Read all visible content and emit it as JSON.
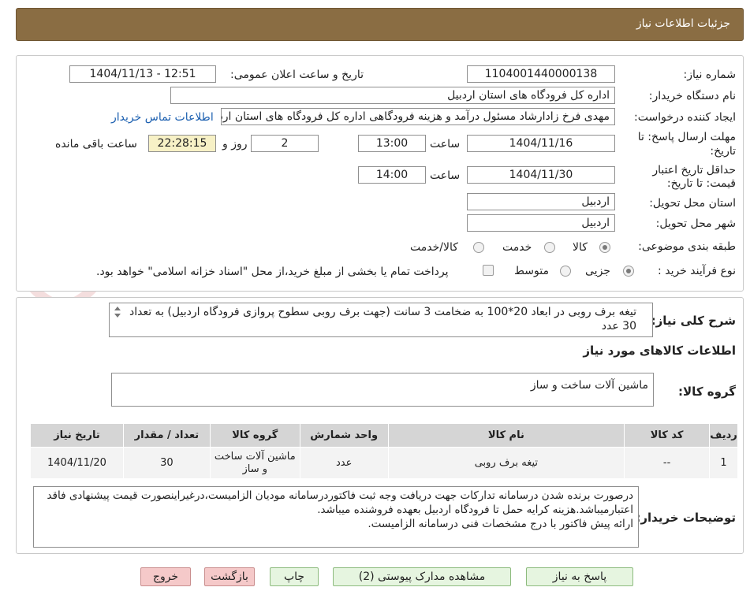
{
  "header": {
    "title": "جزئیات اطلاعات نیاز"
  },
  "form": {
    "need_number_label": "شماره نیاز:",
    "need_number": "1104001440000138",
    "announce_label": "تاریخ و ساعت اعلان عمومی:",
    "announce_value": "1404/11/13 - 12:51",
    "buyer_org_label": "نام دستگاه خریدار:",
    "buyer_org": "اداره کل فرودگاه های استان اردبیل",
    "creator_label": "ایجاد کننده درخواست:",
    "creator": "مهدی فرخ زادارشاد مسئول درآمد و هزینه فرودگاهی اداره کل فرودگاه های استان اردبیل",
    "contact_link": "اطلاعات تماس خریدار",
    "deadline_label_1": "مهلت ارسال پاسخ: تا",
    "deadline_label_2": "تاریخ:",
    "deadline_date": "1404/11/16",
    "time_label": "ساعت",
    "deadline_time": "13:00",
    "days_value": "2",
    "days_label": "روز و",
    "remaining_time": "22:28:15",
    "remaining_label": "ساعت باقی مانده",
    "validity_label_1": "حداقل تاریخ اعتبار",
    "validity_label_2": "قیمت: تا تاریخ:",
    "validity_date": "1404/11/30",
    "validity_time": "14:00",
    "province_label": "استان محل تحویل:",
    "province": "اردبیل",
    "city_label": "شهر محل تحویل:",
    "city": "اردبیل",
    "category_label": "طبقه بندی موضوعی:",
    "category_options": [
      "کالا",
      "خدمت",
      "کالا/خدمت"
    ],
    "category_selected": "کالا",
    "process_label": "نوع فرآیند خرید :",
    "process_options": [
      "جزیی",
      "متوسط"
    ],
    "process_selected": "جزیی",
    "payment_note": "پرداخت تمام یا بخشی از مبلغ خرید،از محل \"اسناد خزانه اسلامی\" خواهد بود."
  },
  "description": {
    "label": "شرح کلی نیاز:",
    "text": "تیغه برف روبی در ابعاد 20*100 به ضخامت 3 سانت (جهت برف روبی سطوح پروازی فرودگاه اردبیل) به تعداد 30 عدد"
  },
  "goods": {
    "section_title": "اطلاعات کالاهای مورد نیاز",
    "group_label": "گروه کالا:",
    "group_value": "ماشین آلات ساخت و ساز",
    "columns": [
      "ردیف",
      "کد کالا",
      "نام کالا",
      "واحد شمارش",
      "گروه کالا",
      "تعداد / مقدار",
      "تاریخ نیاز"
    ],
    "rows": [
      {
        "row": "1",
        "code": "--",
        "name": "تیغه برف روبی",
        "unit": "عدد",
        "group": "ماشین آلات ساخت و ساز",
        "qty": "30",
        "date": "1404/11/20"
      }
    ]
  },
  "notes": {
    "label": "توضیحات خریدار:",
    "text": "درصورت برنده شدن درسامانه تدارکات جهت دریافت وجه ثبت فاکتوردرسامانه مودیان الزامیست،درغیراینصورت قیمت پیشنهادی فاقد اعتبارمیباشد.هزینه کرایه حمل تا فرودگاه اردبیل بعهده فروشنده میباشد.\nارائه پیش فاکتور با درج مشخصات فنی درسامانه الزامیست."
  },
  "buttons": {
    "respond": "پاسخ به نیاز",
    "attachments": "مشاهده مدارک پیوستی (2)",
    "print": "چاپ",
    "back": "بازگشت",
    "exit": "خروج"
  },
  "colors": {
    "header": "#8a6d43",
    "link": "#1b5fb0",
    "button_green": "#e6f5e0",
    "button_pink": "#f5c9c9"
  },
  "watermark": {
    "text": "AriaTender.neT"
  }
}
